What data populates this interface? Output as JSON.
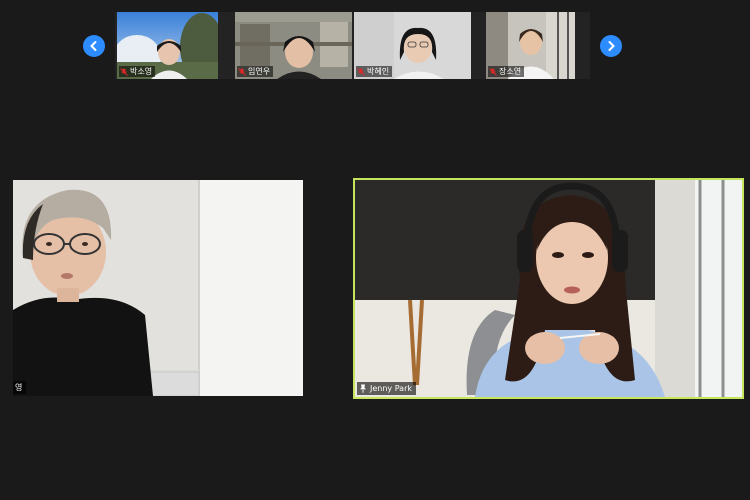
{
  "gallery": {
    "prev_icon": "chevron-left-icon",
    "next_icon": "chevron-right-icon",
    "participants": [
      {
        "name": "박소영",
        "muted": true
      },
      {
        "name": "임연우",
        "muted": true
      },
      {
        "name": "박혜인",
        "muted": true
      },
      {
        "name": "장소연",
        "muted": true
      }
    ]
  },
  "main": {
    "left_tile": {
      "name_fragment": "영"
    },
    "right_tile": {
      "name": "Jenny Park",
      "pinned": true,
      "active_speaker_color": "#c5e55d"
    }
  },
  "colors": {
    "accent": "#2d8cff",
    "muted_mic": "#e02828",
    "background": "#1a1a1a"
  }
}
